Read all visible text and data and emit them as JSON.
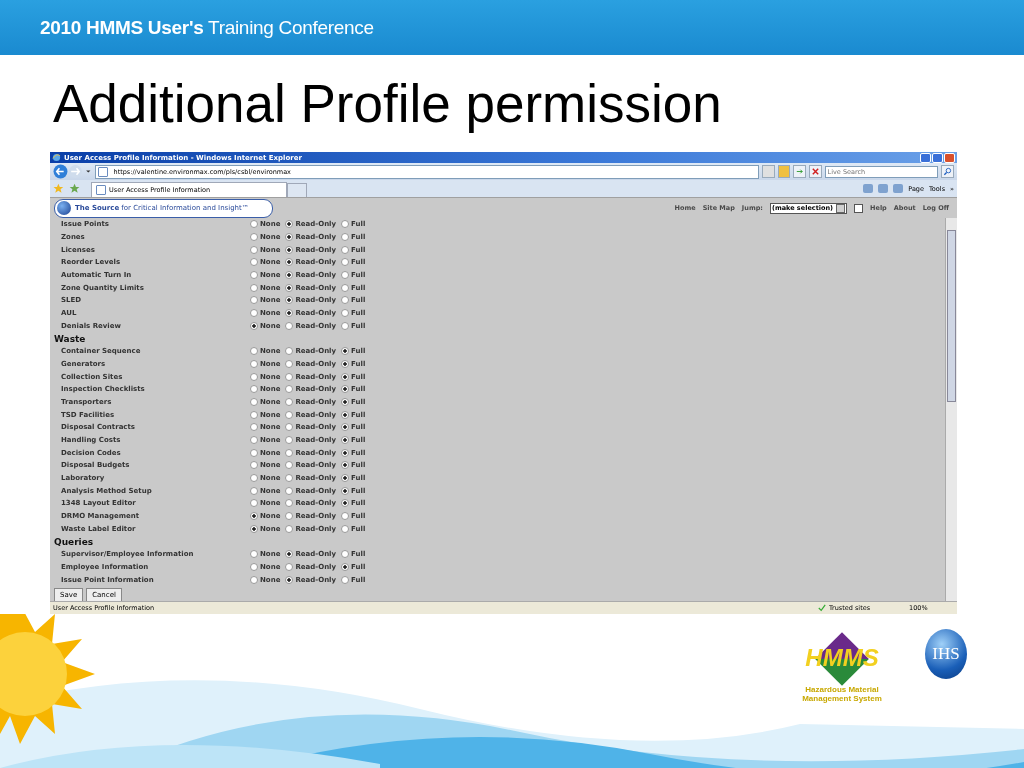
{
  "header": {
    "title": "**2010 HMMS User's** Training Conference"
  },
  "slide_title": "Additional Profile permission",
  "browser": {
    "window_title": "User Access Profile Information - Windows Internet Explorer",
    "address": "https://valentine.environmax.com/pls/csbl/environmax",
    "search": {
      "placeholder": "Live Search"
    },
    "tab": "User Access Profile Information",
    "toolbar": {
      "page": "Page",
      "tools": "Tools",
      "more": "»"
    },
    "status": {
      "text": "User Access Profile Information",
      "zone": "Trusted sites",
      "zoom": "100%"
    }
  },
  "app": {
    "tagline": "**The Source** for Critical Information and Insight™",
    "nav": [
      "Home",
      "Site Map"
    ],
    "jump_label": "Jump:",
    "jump_value": "(make selection)",
    "jump_checked": false,
    "nav_right": [
      "Help",
      "About",
      "Log Off"
    ],
    "groups": [
      {
        "rows": [
          {
            "name": "Issue Points",
            "options": [
              {
                "label": "None",
                "selected": false
              },
              {
                "label": "Read-Only",
                "selected": true
              },
              {
                "label": "Full",
                "selected": false
              }
            ]
          },
          {
            "name": "Zones",
            "options": [
              {
                "label": "None",
                "selected": false
              },
              {
                "label": "Read-Only",
                "selected": true
              },
              {
                "label": "Full",
                "selected": false
              }
            ]
          },
          {
            "name": "Licenses",
            "options": [
              {
                "label": "None",
                "selected": false
              },
              {
                "label": "Read-Only",
                "selected": true
              },
              {
                "label": "Full",
                "selected": false
              }
            ]
          },
          {
            "name": "Reorder Levels",
            "options": [
              {
                "label": "None",
                "selected": false
              },
              {
                "label": "Read-Only",
                "selected": true
              },
              {
                "label": "Full",
                "selected": false
              }
            ]
          },
          {
            "name": "Automatic Turn In",
            "options": [
              {
                "label": "None",
                "selected": false
              },
              {
                "label": "Read-Only",
                "selected": true
              },
              {
                "label": "Full",
                "selected": false
              }
            ]
          },
          {
            "name": "Zone Quantity Limits",
            "options": [
              {
                "label": "None",
                "selected": false
              },
              {
                "label": "Read-Only",
                "selected": true
              },
              {
                "label": "Full",
                "selected": false
              }
            ]
          },
          {
            "name": "SLED",
            "options": [
              {
                "label": "None",
                "selected": false
              },
              {
                "label": "Read-Only",
                "selected": true
              },
              {
                "label": "Full",
                "selected": false
              }
            ]
          },
          {
            "name": "AUL",
            "options": [
              {
                "label": "None",
                "selected": false
              },
              {
                "label": "Read-Only",
                "selected": true
              },
              {
                "label": "Full",
                "selected": false
              }
            ]
          },
          {
            "name": "Denials Review",
            "options": [
              {
                "label": "None",
                "selected": true
              },
              {
                "label": "Read-Only",
                "selected": false
              },
              {
                "label": "Full",
                "selected": false
              }
            ]
          }
        ]
      },
      {
        "heading": "Waste",
        "rows": [
          {
            "name": "Container Sequence",
            "options": [
              {
                "label": "None",
                "selected": false
              },
              {
                "label": "Read-Only",
                "selected": false
              },
              {
                "label": "Full",
                "selected": true
              }
            ]
          },
          {
            "name": "Generators",
            "options": [
              {
                "label": "None",
                "selected": false
              },
              {
                "label": "Read-Only",
                "selected": false
              },
              {
                "label": "Full",
                "selected": true
              }
            ]
          },
          {
            "name": "Collection Sites",
            "options": [
              {
                "label": "None",
                "selected": false
              },
              {
                "label": "Read-Only",
                "selected": false
              },
              {
                "label": "Full",
                "selected": true
              }
            ]
          },
          {
            "name": "Inspection Checklists",
            "options": [
              {
                "label": "None",
                "selected": false
              },
              {
                "label": "Read-Only",
                "selected": false
              },
              {
                "label": "Full",
                "selected": true
              }
            ]
          },
          {
            "name": "Transporters",
            "options": [
              {
                "label": "None",
                "selected": false
              },
              {
                "label": "Read-Only",
                "selected": false
              },
              {
                "label": "Full",
                "selected": true
              }
            ]
          },
          {
            "name": "TSD Facilities",
            "options": [
              {
                "label": "None",
                "selected": false
              },
              {
                "label": "Read-Only",
                "selected": false
              },
              {
                "label": "Full",
                "selected": true
              }
            ]
          },
          {
            "name": "Disposal Contracts",
            "options": [
              {
                "label": "None",
                "selected": false
              },
              {
                "label": "Read-Only",
                "selected": false
              },
              {
                "label": "Full",
                "selected": true
              }
            ]
          },
          {
            "name": "Handling Costs",
            "options": [
              {
                "label": "None",
                "selected": false
              },
              {
                "label": "Read-Only",
                "selected": false
              },
              {
                "label": "Full",
                "selected": true
              }
            ]
          },
          {
            "name": "Decision Codes",
            "options": [
              {
                "label": "None",
                "selected": false
              },
              {
                "label": "Read-Only",
                "selected": false
              },
              {
                "label": "Full",
                "selected": true
              }
            ]
          },
          {
            "name": "Disposal Budgets",
            "options": [
              {
                "label": "None",
                "selected": false
              },
              {
                "label": "Read-Only",
                "selected": false
              },
              {
                "label": "Full",
                "selected": true
              }
            ]
          },
          {
            "name": "Laboratory",
            "options": [
              {
                "label": "None",
                "selected": false
              },
              {
                "label": "Read-Only",
                "selected": false
              },
              {
                "label": "Full",
                "selected": true
              }
            ]
          },
          {
            "name": "Analysis Method Setup",
            "options": [
              {
                "label": "None",
                "selected": false
              },
              {
                "label": "Read-Only",
                "selected": false
              },
              {
                "label": "Full",
                "selected": true
              }
            ]
          },
          {
            "name": "1348 Layout Editor",
            "options": [
              {
                "label": "None",
                "selected": false
              },
              {
                "label": "Read-Only",
                "selected": false
              },
              {
                "label": "Full",
                "selected": true
              }
            ]
          },
          {
            "name": "DRMO Management",
            "options": [
              {
                "label": "None",
                "selected": true
              },
              {
                "label": "Read-Only",
                "selected": false
              },
              {
                "label": "Full",
                "selected": false
              }
            ]
          },
          {
            "name": "Waste Label Editor",
            "options": [
              {
                "label": "None",
                "selected": true
              },
              {
                "label": "Read-Only",
                "selected": false
              },
              {
                "label": "Full",
                "selected": false
              }
            ]
          }
        ]
      },
      {
        "heading": "Queries",
        "rows": [
          {
            "name": "Supervisor/Employee Information",
            "options": [
              {
                "label": "None",
                "selected": false
              },
              {
                "label": "Read-Only",
                "selected": true
              },
              {
                "label": "Full",
                "selected": false
              }
            ]
          },
          {
            "name": "Employee Information",
            "options": [
              {
                "label": "None",
                "selected": false
              },
              {
                "label": "Read-Only",
                "selected": false
              },
              {
                "label": "Full",
                "selected": true
              }
            ]
          },
          {
            "name": "Issue Point Information",
            "options": [
              {
                "label": "None",
                "selected": false
              },
              {
                "label": "Read-Only",
                "selected": true
              },
              {
                "label": "Full",
                "selected": false
              }
            ]
          }
        ]
      }
    ],
    "buttons": [
      "Save",
      "Cancel"
    ]
  },
  "logos": {
    "hmms": "HMMS",
    "hmms_sub": [
      "Hazardous Material",
      "Management System"
    ],
    "ihs": "IHS"
  }
}
